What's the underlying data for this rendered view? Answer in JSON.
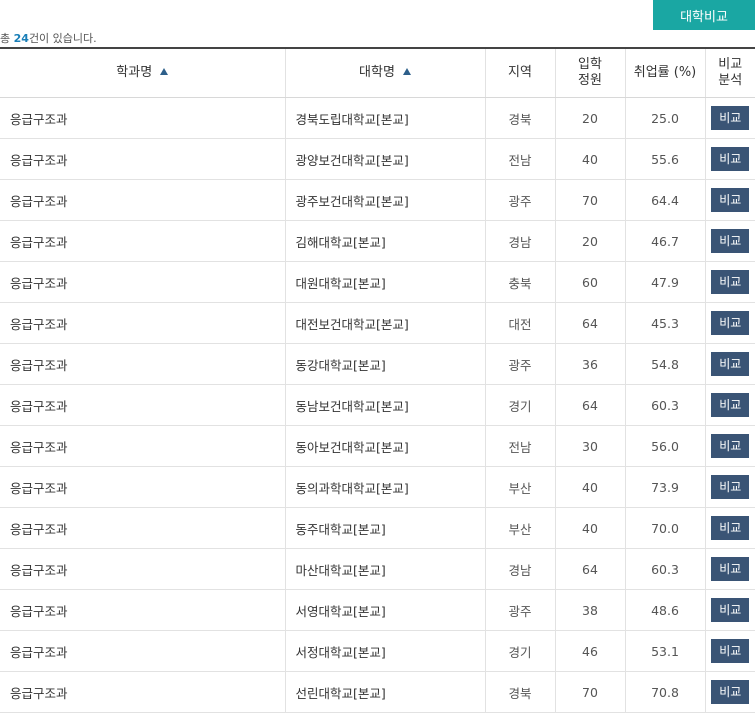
{
  "compare_button_label": "대학비교",
  "summary": {
    "prefix": "총 ",
    "count": "24",
    "suffix": "건이 있습니다."
  },
  "table": {
    "headers": {
      "department": "학과명",
      "university": "대학명",
      "region": "지역",
      "quota_line1": "입학",
      "quota_line2": "정원",
      "employment_rate": "취업률 (%)",
      "compare_line1": "비교",
      "compare_line2": "분석"
    },
    "compare_cell_label": "비교",
    "rows": [
      {
        "department": "응급구조과",
        "university": "경북도립대학교[본교]",
        "region": "경북",
        "quota": "20",
        "rate": "25.0"
      },
      {
        "department": "응급구조과",
        "university": "광양보건대학교[본교]",
        "region": "전남",
        "quota": "40",
        "rate": "55.6"
      },
      {
        "department": "응급구조과",
        "university": "광주보건대학교[본교]",
        "region": "광주",
        "quota": "70",
        "rate": "64.4"
      },
      {
        "department": "응급구조과",
        "university": "김해대학교[본교]",
        "region": "경남",
        "quota": "20",
        "rate": "46.7"
      },
      {
        "department": "응급구조과",
        "university": "대원대학교[본교]",
        "region": "충북",
        "quota": "60",
        "rate": "47.9"
      },
      {
        "department": "응급구조과",
        "university": "대전보건대학교[본교]",
        "region": "대전",
        "quota": "64",
        "rate": "45.3"
      },
      {
        "department": "응급구조과",
        "university": "동강대학교[본교]",
        "region": "광주",
        "quota": "36",
        "rate": "54.8"
      },
      {
        "department": "응급구조과",
        "university": "동남보건대학교[본교]",
        "region": "경기",
        "quota": "64",
        "rate": "60.3"
      },
      {
        "department": "응급구조과",
        "university": "동아보건대학교[본교]",
        "region": "전남",
        "quota": "30",
        "rate": "56.0"
      },
      {
        "department": "응급구조과",
        "university": "동의과학대학교[본교]",
        "region": "부산",
        "quota": "40",
        "rate": "73.9"
      },
      {
        "department": "응급구조과",
        "university": "동주대학교[본교]",
        "region": "부산",
        "quota": "40",
        "rate": "70.0"
      },
      {
        "department": "응급구조과",
        "university": "마산대학교[본교]",
        "region": "경남",
        "quota": "64",
        "rate": "60.3"
      },
      {
        "department": "응급구조과",
        "university": "서영대학교[본교]",
        "region": "광주",
        "quota": "38",
        "rate": "48.6"
      },
      {
        "department": "응급구조과",
        "university": "서정대학교[본교]",
        "region": "경기",
        "quota": "46",
        "rate": "53.1"
      },
      {
        "department": "응급구조과",
        "university": "선린대학교[본교]",
        "region": "경북",
        "quota": "70",
        "rate": "70.8"
      }
    ]
  }
}
